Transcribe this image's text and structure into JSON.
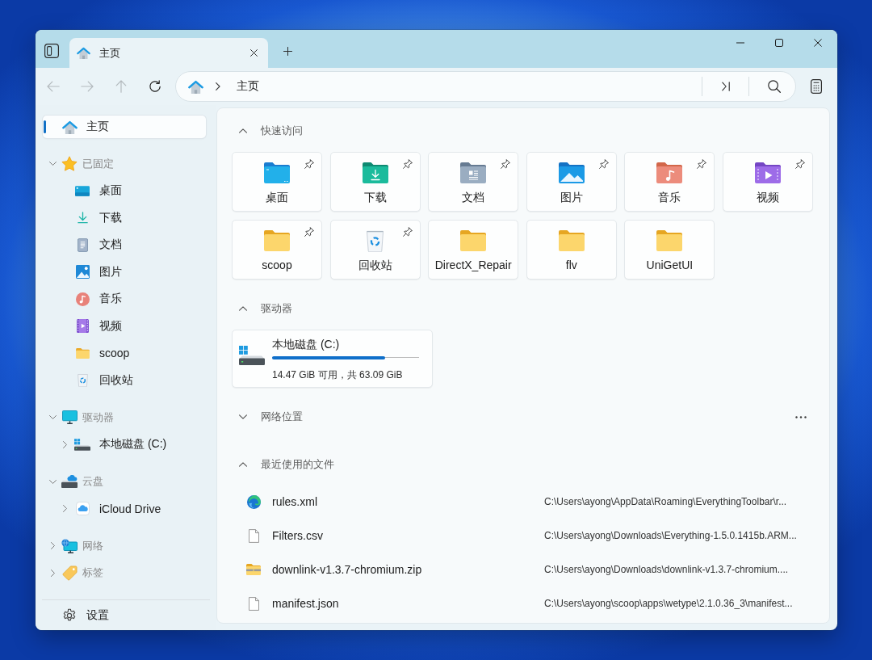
{
  "window": {
    "tabs": [
      {
        "label": "主页",
        "selected": true
      }
    ]
  },
  "toolbar": {
    "nav_buttons": [
      {
        "kind": "back",
        "disabled": true
      },
      {
        "kind": "forward",
        "disabled": true
      },
      {
        "kind": "up",
        "disabled": true
      },
      {
        "kind": "refresh",
        "disabled": false
      }
    ],
    "address_bar": {
      "path": [
        "主页"
      ]
    }
  },
  "sidebar": {
    "home": {
      "label": "主页",
      "selected": true
    },
    "tree": [
      {
        "kind": "star",
        "label": "已固定",
        "selected": false,
        "expanded": true,
        "children": [
          {
            "kind": "desktop",
            "label": "桌面",
            "selected": false
          },
          {
            "kind": "downloads",
            "label": "下载",
            "selected": false
          },
          {
            "kind": "documents",
            "label": "文档",
            "selected": false
          },
          {
            "kind": "pictures",
            "label": "图片",
            "selected": false
          },
          {
            "kind": "music",
            "label": "音乐",
            "selected": false
          },
          {
            "kind": "videos",
            "label": "视频",
            "selected": false
          },
          {
            "kind": "folder",
            "label": "scoop",
            "selected": false
          },
          {
            "kind": "recycle-bin",
            "label": "回收站",
            "selected": false
          }
        ]
      },
      {
        "kind": "monitor",
        "label": "驱动器",
        "selected": false,
        "expanded": true,
        "children": [
          {
            "kind": "drive",
            "label": "本地磁盘 (C:)",
            "selected": false,
            "expanded": false
          }
        ]
      },
      {
        "kind": "cloud-drive",
        "label": "云盘",
        "selected": false,
        "expanded": true,
        "children": [
          {
            "kind": "cloud",
            "label": "iCloud Drive",
            "selected": false,
            "expanded": false
          }
        ]
      },
      {
        "kind": "network",
        "label": "网络",
        "selected": false,
        "expanded": false
      },
      {
        "kind": "tag",
        "label": "标签",
        "selected": false,
        "expanded": false
      }
    ],
    "settings": {
      "label": "设置"
    }
  },
  "home": {
    "sections": [
      {
        "kind": "tiles",
        "title": "快速访问",
        "expanded": true,
        "more_button": false,
        "items": [
          {
            "kind": "desktop",
            "label": "桌面",
            "pinned": true
          },
          {
            "kind": "downloads",
            "label": "下载",
            "pinned": true
          },
          {
            "kind": "documents",
            "label": "文档",
            "pinned": true
          },
          {
            "kind": "pictures",
            "label": "图片",
            "pinned": true
          },
          {
            "kind": "music",
            "label": "音乐",
            "pinned": true
          },
          {
            "kind": "videos",
            "label": "视频",
            "pinned": true
          },
          {
            "kind": "folder",
            "label": "scoop",
            "pinned": true
          },
          {
            "kind": "recycle-bin",
            "label": "回收站",
            "pinned": true
          },
          {
            "kind": "folder",
            "label": "DirectX_Repair",
            "pinned": false
          },
          {
            "kind": "folder",
            "label": "flv",
            "pinned": false
          },
          {
            "kind": "folder",
            "label": "UniGetUI",
            "pinned": false
          }
        ]
      },
      {
        "kind": "drives",
        "title": "驱动器",
        "expanded": true,
        "more_button": false,
        "items": [
          {
            "label": "本地磁盘 (C:)",
            "level": 0.77,
            "space": "14.47 GiB 可用，共 63.09 GiB"
          }
        ]
      },
      {
        "title": "网络位置",
        "expanded": false,
        "more_button": true
      },
      {
        "kind": "files",
        "title": "最近使用的文件",
        "expanded": true,
        "more_button": false,
        "items": [
          {
            "kind": "browser",
            "name": "rules.xml",
            "path": "C:\\Users\\ayong\\AppData\\Roaming\\EverythingToolbar\\r..."
          },
          {
            "kind": "file",
            "name": "Filters.csv",
            "path": "C:\\Users\\ayong\\Downloads\\Everything-1.5.0.1415b.ARM..."
          },
          {
            "kind": "zip",
            "name": "downlink-v1.3.7-chromium.zip",
            "path": "C:\\Users\\ayong\\Downloads\\downlink-v1.3.7-chromium...."
          },
          {
            "kind": "file",
            "name": "manifest.json",
            "path": "C:\\Users\\ayong\\scoop\\apps\\wetype\\2.1.0.36_3\\manifest..."
          }
        ]
      }
    ]
  }
}
